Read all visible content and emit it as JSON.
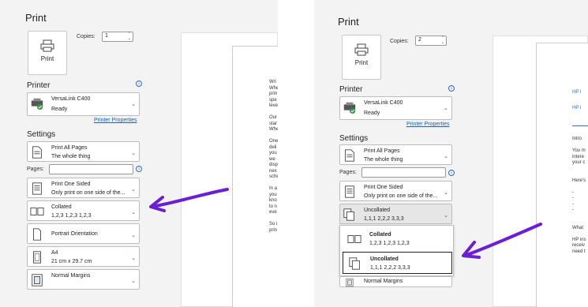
{
  "left": {
    "title": "Print",
    "print_button": "Print",
    "copies_label": "Copies:",
    "copies_value": "1",
    "printer_heading": "Printer",
    "printer_name": "VersaLink C400",
    "printer_status": "Ready",
    "printer_properties": "Printer Properties",
    "settings_heading": "Settings",
    "pages_scope": {
      "line1": "Print All Pages",
      "line2": "The whole thing"
    },
    "pages_label": "Pages:",
    "sides": {
      "line1": "Print One Sided",
      "line2": "Only print on one side of the..."
    },
    "collation": {
      "line1": "Collated",
      "line2": "1,2,3   1,2,3   1,2,3"
    },
    "orientation": "Portrait Orientation",
    "paper": {
      "line1": "A4",
      "line2": "21 cm x 29.7 cm"
    },
    "margins": {
      "line1": "Normal Margins",
      "line2": ""
    },
    "preview_lines": [
      "Wri",
      "Whe",
      "prin",
      "spe",
      "leve",
      "",
      "Our",
      "star",
      "Whe",
      "",
      "One",
      "deli",
      "you",
      "we",
      "disp",
      "nex",
      "sche",
      "",
      "In a",
      "you",
      "kno",
      "to n",
      "eve",
      "",
      "So i",
      "prin"
    ]
  },
  "right": {
    "title": "Print",
    "print_button": "Print",
    "copies_label": "Copies:",
    "copies_value": "2",
    "printer_heading": "Printer",
    "printer_name": "VersaLink C400",
    "printer_status": "Ready",
    "printer_properties": "Printer Properties",
    "settings_heading": "Settings",
    "pages_scope": {
      "line1": "Print All Pages",
      "line2": "The whole thing"
    },
    "pages_label": "Pages:",
    "sides": {
      "line1": "Print One Sided",
      "line2": "Only print on one side of the..."
    },
    "collation": {
      "line1": "Uncollated",
      "line2": "1,1,1   2,2,2   3,3,3"
    },
    "menu": [
      {
        "line1": "Collated",
        "line2": "1,2,3   1,2,3   1,2,3"
      },
      {
        "line1": "Uncollated",
        "line2": "1,1,1   2,2,2   3,3,3"
      }
    ],
    "margins_partial": "Normal Margins",
    "preview_links": [
      "HP I",
      "HP I"
    ],
    "preview_lines": [
      "Intro",
      "",
      "You m",
      "intere",
      "your c",
      "",
      "",
      "Here's",
      "",
      "-",
      "-",
      "-",
      "-",
      "",
      "",
      "What",
      "",
      "HP ins",
      "receiv",
      "need t"
    ]
  },
  "colors": {
    "accent": "#1a5fb4",
    "arrow": "#6a1fd6",
    "status_ok": "#2e9b3a"
  }
}
